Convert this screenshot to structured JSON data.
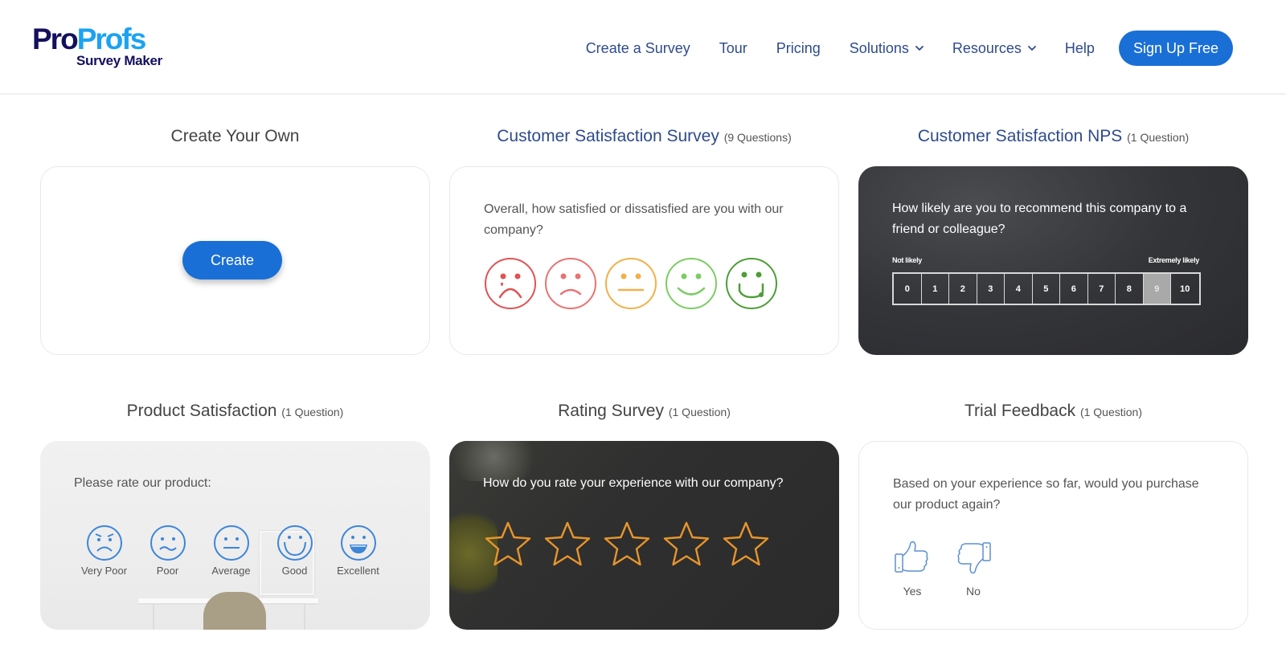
{
  "header": {
    "logo": {
      "pro": "Pro",
      "profs": "Profs",
      "sub": "Survey Maker"
    },
    "nav": [
      {
        "label": "Create a Survey",
        "dropdown": false
      },
      {
        "label": "Tour",
        "dropdown": false
      },
      {
        "label": "Pricing",
        "dropdown": false
      },
      {
        "label": "Solutions",
        "dropdown": true
      },
      {
        "label": "Resources",
        "dropdown": true
      },
      {
        "label": "Help",
        "dropdown": false
      }
    ],
    "cta": "Sign Up Free"
  },
  "colors": {
    "brand_dark": "#14105d",
    "brand_light": "#1aa3f2",
    "nav_text": "#2f4b8c",
    "primary_button": "#1a6fd6",
    "star_outline": "#e8952b",
    "face_blue": "#3d85d8"
  },
  "templates": [
    {
      "title": "Create Your Own",
      "count": "",
      "button": "Create"
    },
    {
      "title": "Customer Satisfaction Survey",
      "count": "(9 Questions)",
      "question": "Overall, how satisfied or dissatisfied are you with our company?",
      "options": [
        "very-dissatisfied-face-icon",
        "dissatisfied-face-icon",
        "neutral-face-icon",
        "satisfied-face-icon",
        "very-satisfied-face-icon"
      ]
    },
    {
      "title": "Customer Satisfaction NPS",
      "count": "(1 Question)",
      "question": "How likely are you to recommend this company to a friend or colleague?",
      "low_label": "Not likely",
      "high_label": "Extremely likely",
      "scale": [
        "0",
        "1",
        "2",
        "3",
        "4",
        "5",
        "6",
        "7",
        "8",
        "9",
        "10"
      ],
      "selected": "9"
    },
    {
      "title": "Product Satisfaction",
      "count": "(1 Question)",
      "question": "Please rate our product:",
      "options": [
        "Very Poor",
        "Poor",
        "Average",
        "Good",
        "Excellent"
      ]
    },
    {
      "title": "Rating Survey",
      "count": "(1 Question)",
      "question": "How do you rate your experience with our company?",
      "stars": 5
    },
    {
      "title": "Trial Feedback",
      "count": "(1 Question)",
      "question": "Based on your experience so far, would you purchase our product again?",
      "options": [
        "Yes",
        "No"
      ]
    }
  ]
}
